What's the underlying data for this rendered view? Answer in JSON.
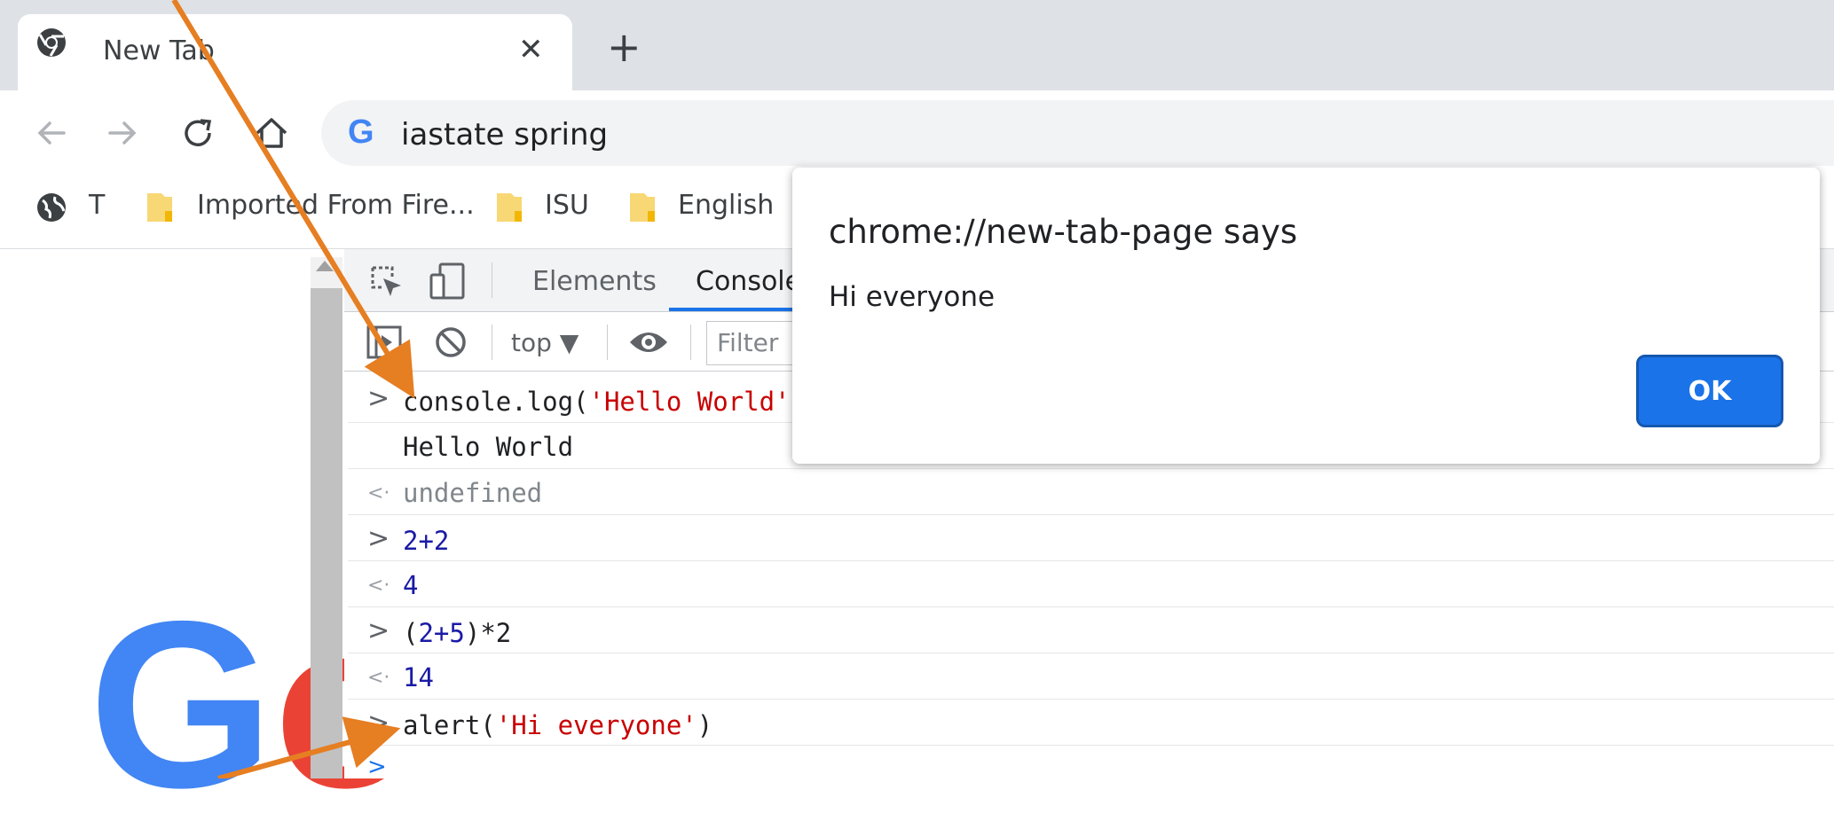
{
  "browser": {
    "tab_title": "New Tab",
    "tab_close": "✕",
    "new_tab": "+",
    "omnibox_text": "iastate spring",
    "bookmarks": [
      {
        "label": "T"
      },
      {
        "label": "Imported From Fire..."
      },
      {
        "label": "ISU"
      },
      {
        "label": "English"
      }
    ]
  },
  "devtools": {
    "tabs": [
      "Elements",
      "Console"
    ],
    "context": "top ▼",
    "filter_placeholder": "Filter",
    "rows": [
      {
        "code": "console.log(",
        "string": "'Hello World'",
        "close": ")"
      },
      {
        "output": "Hello World"
      },
      {
        "result": "undefined"
      },
      {
        "input": "2+2"
      },
      {
        "result": "4"
      },
      {
        "input_a": "(",
        "input_b": "2+5",
        "input_c": ")*2"
      },
      {
        "result": "14"
      },
      {
        "code": "alert(",
        "string": "'Hi everyone'",
        "close": ")"
      }
    ]
  },
  "dialog": {
    "title": "chrome://new-tab-page says",
    "message": "Hi everyone",
    "ok_label": "OK"
  },
  "page": {
    "logo_g": "G",
    "logo_o": "o"
  },
  "colors": {
    "accent": "#1a73e8",
    "arrow": "#e67e22",
    "string": "#c80000",
    "number": "#1a1aa6"
  }
}
